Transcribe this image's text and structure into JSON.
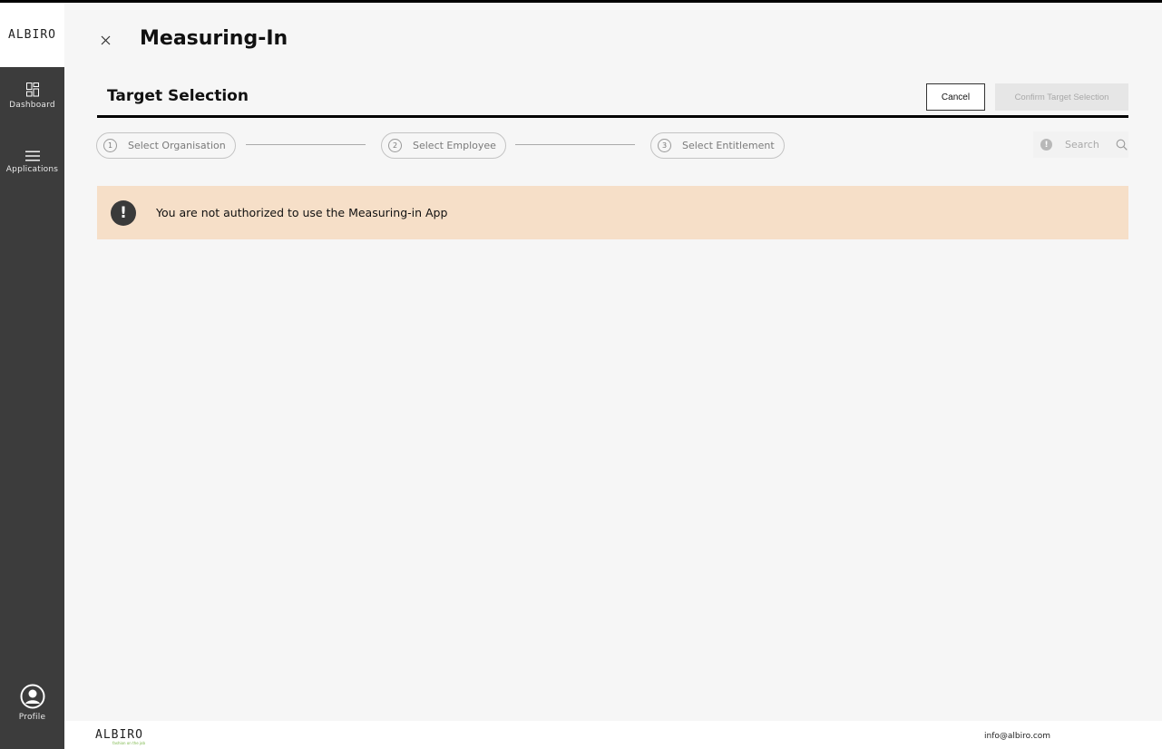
{
  "brand": {
    "name": "ALBIRO",
    "tagline": "fashion on the job"
  },
  "sidebar": {
    "items": [
      {
        "label": "Dashboard",
        "icon": "dashboard-grid-icon"
      },
      {
        "label": "Applications",
        "icon": "hamburger-menu-icon"
      }
    ],
    "profile": {
      "label": "Profile",
      "icon": "user-circle-icon"
    }
  },
  "header": {
    "title": "Measuring-In",
    "close_icon": "close-icon"
  },
  "section": {
    "title": "Target Selection",
    "cancel_label": "Cancel",
    "confirm_label": "Confirm Target Selection",
    "confirm_enabled": false
  },
  "stepper": {
    "steps": [
      {
        "num": "1",
        "label": "Select Organisation"
      },
      {
        "num": "2",
        "label": "Select Employee"
      },
      {
        "num": "3",
        "label": "Select Entitlement"
      }
    ]
  },
  "search": {
    "placeholder": "Search",
    "value": ""
  },
  "alert": {
    "icon": "exclamation-icon",
    "message": "You are not authorized to use the Measuring-in App",
    "background": "#f6dfc8"
  },
  "footer": {
    "email": "info@albiro.com"
  },
  "colors": {
    "sidebar": "#3c3c3c",
    "page": "#f6f6f6",
    "accent": "#7ab648"
  }
}
